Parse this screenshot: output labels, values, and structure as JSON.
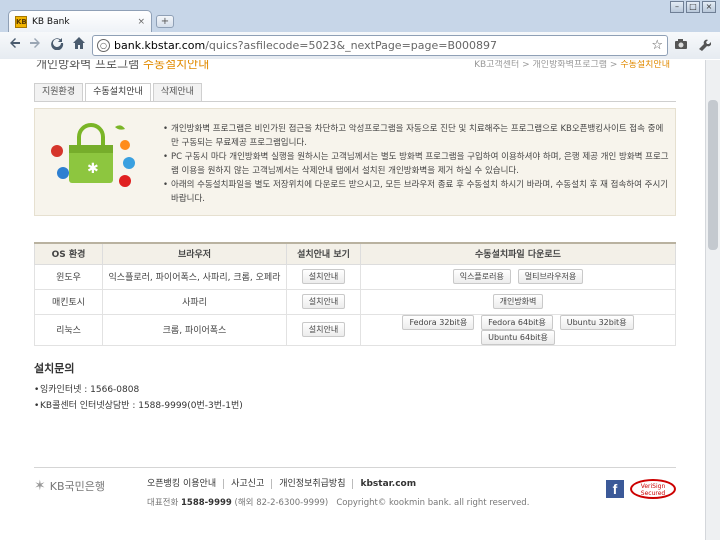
{
  "window": {
    "tab_title": "KB Bank",
    "tab_close": "×",
    "newtab": "+",
    "favicon": "KB"
  },
  "toolbar": {
    "url_host": "bank.kbstar.com",
    "url_path": "/quics?asfilecode=5023&_nextPage=page=B000897",
    "icons": [
      "back-icon",
      "forward-icon",
      "reload-icon",
      "home-icon",
      "page-icon",
      "star-icon",
      "camera-icon",
      "wrench-icon"
    ]
  },
  "page": {
    "header_cut": "개인방화벽 프로그램",
    "header_hl": "수동설치안내",
    "breadcrumb": "KB고객센터 > 개인방화벽프로그램 > ",
    "breadcrumb_current": "수동설치안내",
    "tabs": [
      "지원환경",
      "수동설치안내",
      "삭제안내"
    ],
    "info": [
      "개인방화벽 프로그램은 비인가된 접근을 차단하고 악성프로그램을 자동으로 진단 및 치료해주는 프로그램으로 KB오픈뱅킹사이트 접속 중에만 구동되는 무료제공 프로그램입니다.",
      "PC 구동시 마다 개인방화벽 실행을 원하시는 고객님께서는 별도 방화벽 프로그램을 구입하여 이용하셔야 하며, 은행 제공 개인 방화벽 프로그램 이용을 원하지 않는 고객님께서는 삭제안내 탭에서 설치된 개인방화벽을 제거 하실 수 있습니다.",
      "아래의 수동설치파일을 별도 저장위치에 다운로드 받으시고, 모든 브라우저 종료 후 수동설치 하시기 바라며, 수동설치 후 재 접속하여 주시기 바랍니다."
    ],
    "table": {
      "headers": [
        "OS 환경",
        "브라우저",
        "설치안내 보기",
        "수동설치파일 다운로드"
      ],
      "rows": [
        {
          "os": "윈도우",
          "browser": "익스플로러, 파이어폭스, 사파리, 크롬, 오페라",
          "guide": "설치안내",
          "downloads": [
            "익스플로러용",
            "멀티브라우저용"
          ]
        },
        {
          "os": "매킨토시",
          "browser": "사파리",
          "guide": "설치안내",
          "downloads": [
            "개인방화벽"
          ]
        },
        {
          "os": "리눅스",
          "browser": "크롬, 파이어폭스",
          "guide": "설치안내",
          "downloads": [
            "Fedora 32bit용",
            "Fedora 64bit용",
            "Ubuntu 32bit용",
            "Ubuntu 64bit용"
          ]
        }
      ]
    },
    "inquiry_title": "설치문의",
    "inquiry": [
      "잉카인터넷 : 1566-0808",
      "KB콜센터 인터넷상담반 : 1588-9999(0번-3번-1번)"
    ]
  },
  "footer": {
    "logo": "KB국민은행",
    "links": [
      "오픈뱅킹 이용안내",
      "사고신고",
      "개인정보취급방침",
      "kbstar.com"
    ],
    "rep_label": "대표전화",
    "rep_phone": "1588-9999",
    "rep_overseas": "(해외 82-2-6300-9999)",
    "copyright": "Copyright© kookmin bank. all right reserved.",
    "fb": "f",
    "verisign": "VeriSign Secured"
  }
}
